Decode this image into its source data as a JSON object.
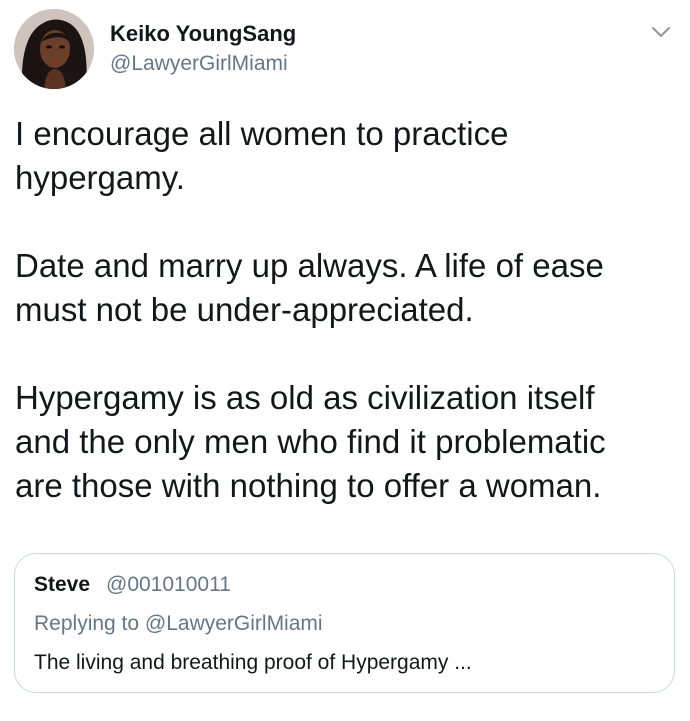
{
  "author": {
    "display_name": "Keiko YoungSang",
    "handle": "@LawyerGirlMiami",
    "avatar_icon": "profile-photo"
  },
  "menu": {
    "icon": "chevron-down-icon"
  },
  "tweet": {
    "lines_p1": [
      "I encourage all women to practice",
      "hypergamy."
    ],
    "lines_p2": [
      "Date and marry up always. A life of ease",
      "must not be under-appreciated."
    ],
    "lines_p3": [
      "Hypergamy is as old as civilization itself",
      "and the only men who find it problematic",
      "are those with nothing to offer a woman."
    ]
  },
  "quoted_tweet": {
    "display_name": "Steve",
    "handle": "@001010011",
    "replying_to": "Replying to @LawyerGirlMiami",
    "text": "The living and breathing proof of Hypergamy ..."
  },
  "colors": {
    "primary_text": "#14171a",
    "secondary_text": "#657786",
    "border": "#ccd6dd"
  }
}
